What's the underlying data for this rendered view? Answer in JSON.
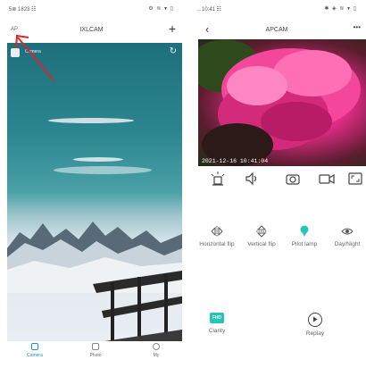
{
  "left_screen": {
    "status": {
      "left": "5≣ 1823 ☷",
      "right": "⚙ ≋ ▾ ▯"
    },
    "nav": {
      "ap_label": "AP",
      "title": "IXLCAM",
      "add_label": "+"
    },
    "camera": {
      "name": "Camera"
    },
    "tabs": [
      {
        "label": "Camera",
        "active": true
      },
      {
        "label": "Photo",
        "active": false
      },
      {
        "label": "My",
        "active": false
      }
    ]
  },
  "right_screen": {
    "status": {
      "left": "…10:41 ☷",
      "right": "✱ ◈ ≋ ▾ ▯"
    },
    "nav": {
      "title": "APCAM",
      "more_label": "•••"
    },
    "video": {
      "timestamp": "2021-12-16 10:41:04"
    },
    "functions": [
      {
        "label": "Horizontal flip",
        "icon": "horizontal-flip-icon"
      },
      {
        "label": "Vertical flip",
        "icon": "vertical-flip-icon"
      },
      {
        "label": "Pilot lamp",
        "icon": "pilot-lamp-icon"
      },
      {
        "label": "Day/Night",
        "icon": "eye-icon"
      }
    ],
    "bottom": [
      {
        "label": "Clarity",
        "badge": "FHD"
      },
      {
        "label": "Replay"
      }
    ]
  },
  "colors": {
    "accent": "#1d8fd8",
    "teal": "#22c7b9",
    "annotation": "#d9262c"
  }
}
